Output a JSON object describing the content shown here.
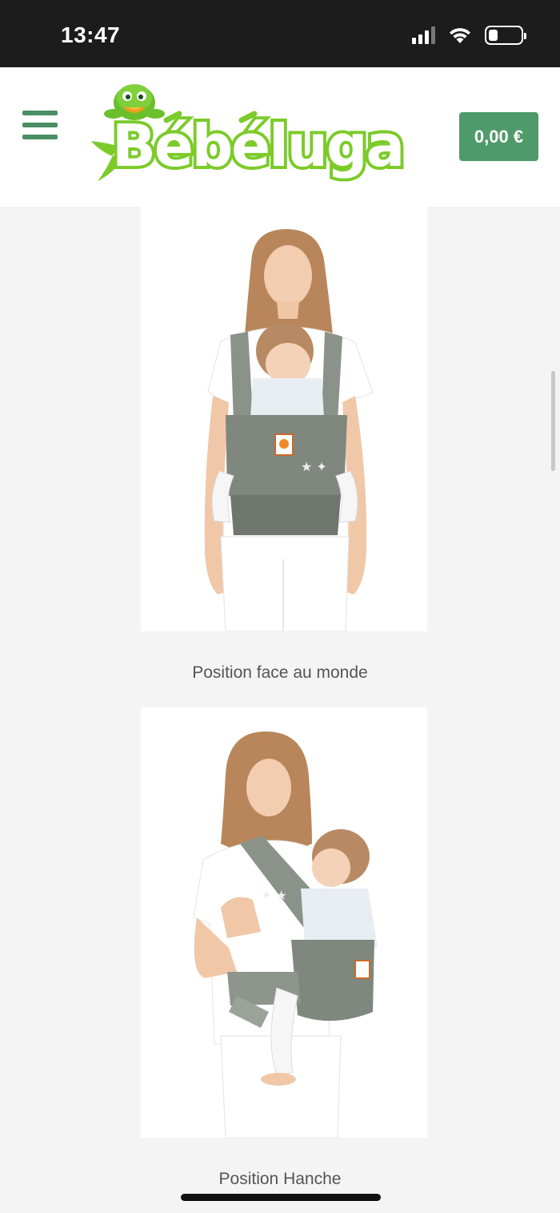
{
  "status_bar": {
    "time": "13:47",
    "icons": [
      "signal-icon",
      "wifi-icon",
      "battery-icon"
    ],
    "battery_level": 0.3
  },
  "header": {
    "brand_name": "Bébéluga",
    "cart_total": "0,00 €",
    "colors": {
      "accent": "#4f9a6a",
      "logo_green": "#7ccb2a"
    }
  },
  "gallery": [
    {
      "caption": "Position face au monde",
      "image": "photo: woman carrying baby facing out in grey carrier"
    },
    {
      "caption": "Position Hanche",
      "image": "photo: woman carrying baby on hip in grey carrier"
    }
  ]
}
